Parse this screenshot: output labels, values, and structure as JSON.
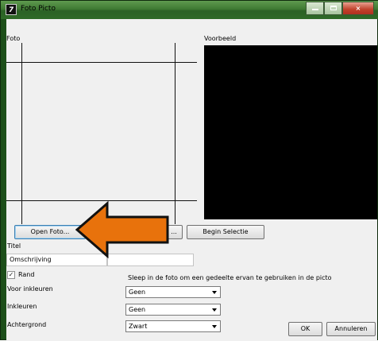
{
  "window": {
    "title": "Foto Picto",
    "icon": "app-icon",
    "controls": {
      "minimize": "minimize-icon",
      "maximize": "maximize-icon",
      "close": "×"
    }
  },
  "labels": {
    "foto": "Foto",
    "voorbeeld": "Voorbeeld",
    "titel": "Titel",
    "voor_inkleuren": "Voor inkleuren",
    "inkleuren": "Inkleuren",
    "achtergrond": "Achtergrond",
    "hint": "Sleep in de foto om een gedeelte ervan te gebruiken in de picto"
  },
  "buttons": {
    "open_foto": "Open Foto...",
    "small_button": "...",
    "begin_selectie": "Begin Selectie",
    "ok": "OK",
    "annuleren": "Annuleren"
  },
  "fields": {
    "titel_value": "",
    "omschrijving_value": "Omschrijving",
    "extra_value": ""
  },
  "checkbox": {
    "label": "Rand",
    "checked": true,
    "mark": "✓"
  },
  "selects": {
    "voor_inkleuren": "Geen",
    "inkleuren": "Geen",
    "achtergrond": "Zwart"
  },
  "colors": {
    "arrow_fill": "#e8720c",
    "arrow_stroke": "#111111",
    "preview_bg": "#000000",
    "titlebar": "#3f7a33"
  },
  "annotation": {
    "icon": "pointer-arrow-icon"
  }
}
